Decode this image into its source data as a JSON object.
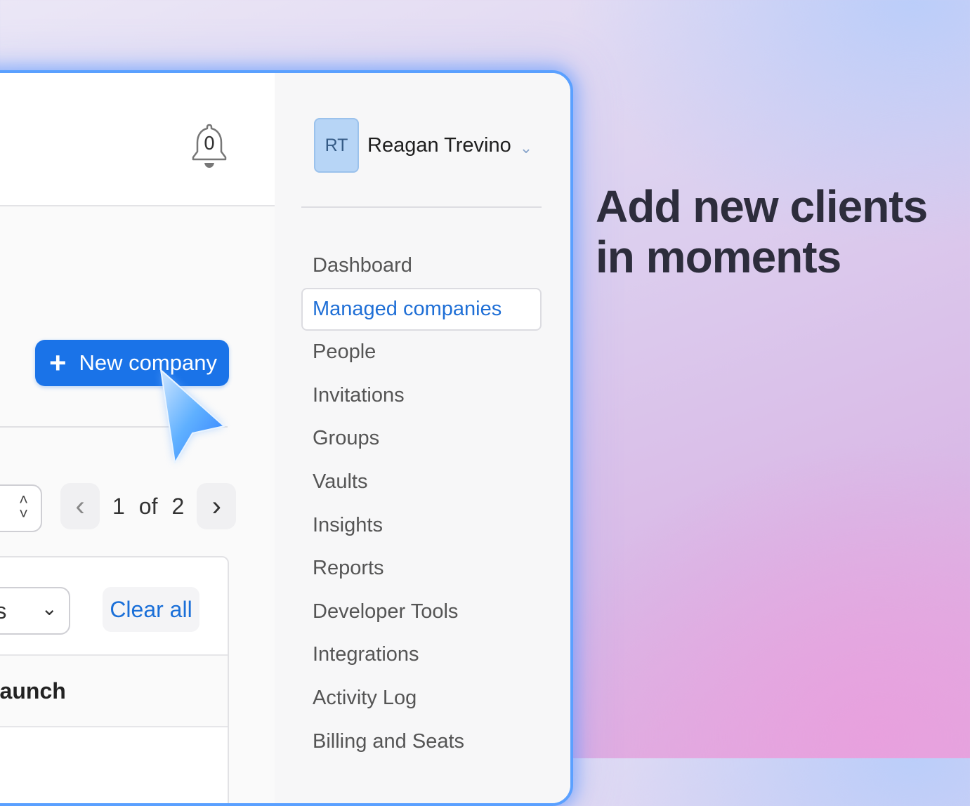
{
  "headline": {
    "line1": "Add new clients",
    "line2": "in moments"
  },
  "header": {
    "notification_count": "0"
  },
  "toolbar": {
    "new_company_label": "New company",
    "plus_symbol": "+"
  },
  "pagination": {
    "current": "1",
    "of_label": "of",
    "total": "2"
  },
  "filters": {
    "status_label": "tatus",
    "clear_all_label": "Clear all"
  },
  "table": {
    "first_row_text": "Launch"
  },
  "user": {
    "initials": "RT",
    "name": "Reagan Trevino"
  },
  "sidebar": {
    "active_index": 1,
    "items": [
      {
        "label": "Dashboard"
      },
      {
        "label": "Managed companies"
      },
      {
        "label": "People"
      },
      {
        "label": "Invitations"
      },
      {
        "label": "Groups"
      },
      {
        "label": "Vaults"
      },
      {
        "label": "Insights"
      },
      {
        "label": "Reports"
      },
      {
        "label": "Developer Tools"
      },
      {
        "label": "Integrations"
      },
      {
        "label": "Activity Log"
      },
      {
        "label": "Billing and Seats"
      }
    ]
  },
  "colors": {
    "accent": "#1a73e8",
    "active_nav_text": "#1f6fd6",
    "window_glow": "#5aa0ff"
  }
}
